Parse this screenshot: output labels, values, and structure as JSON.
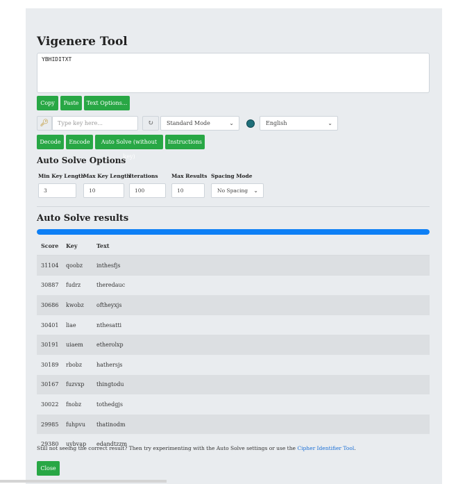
{
  "page": {
    "title": "Vigenere Tool"
  },
  "cipher_text": "YBHIDITXT",
  "text_buttons": {
    "copy": "Copy",
    "paste": "Paste",
    "text_options": "Text Options..."
  },
  "key_row": {
    "key_placeholder": "Type key here...",
    "key_icon": "key-icon",
    "refresh_icon": "refresh-icon",
    "mode": "Standard Mode",
    "language_icon": "globe-icon",
    "language": "English"
  },
  "action_buttons": {
    "decode": "Decode",
    "encode": "Encode",
    "auto_solve": "Auto Solve (without key)",
    "instructions": "Instructions"
  },
  "auto_solve_options": {
    "title": "Auto Solve Options",
    "min_key_length_label": "Min Key Length",
    "min_key_length": "3",
    "max_key_length_label": "Max Key Length",
    "max_key_length": "10",
    "iterations_label": "Iterations",
    "iterations": "100",
    "max_results_label": "Max Results",
    "max_results": "10",
    "spacing_mode_label": "Spacing Mode",
    "spacing_mode": "No Spacing"
  },
  "results": {
    "title": "Auto Solve results",
    "progress": 1.0,
    "headers": {
      "score": "Score",
      "key": "Key",
      "text": "Text"
    },
    "rows": [
      {
        "score": "31104",
        "key": "qoobz",
        "text": "inthesfjs"
      },
      {
        "score": "30887",
        "key": "fudrz",
        "text": "theredauc"
      },
      {
        "score": "30686",
        "key": "kwobz",
        "text": "oftheyxjs"
      },
      {
        "score": "30401",
        "key": "liae",
        "text": "nthesatti"
      },
      {
        "score": "30191",
        "key": "uiaem",
        "text": "etherolxp"
      },
      {
        "score": "30189",
        "key": "rbobz",
        "text": "hathersjs"
      },
      {
        "score": "30167",
        "key": "fuzvxp",
        "text": "thingtodu"
      },
      {
        "score": "30022",
        "key": "fnobz",
        "text": "tothedgjs"
      },
      {
        "score": "29985",
        "key": "fuhpvu",
        "text": "thatinodm"
      },
      {
        "score": "29380",
        "key": "uybvap",
        "text": "edandtzzm"
      }
    ]
  },
  "footnote": {
    "text": "Still not seeing the correct result? Then try experimenting with the Auto Solve settings or use the ",
    "link": "Cipher Identifier Tool",
    "end": "."
  },
  "close_button": "Close",
  "colors": {
    "button": "#28a745",
    "progress": "#0d7ff5",
    "link": "#1a6fd6"
  }
}
